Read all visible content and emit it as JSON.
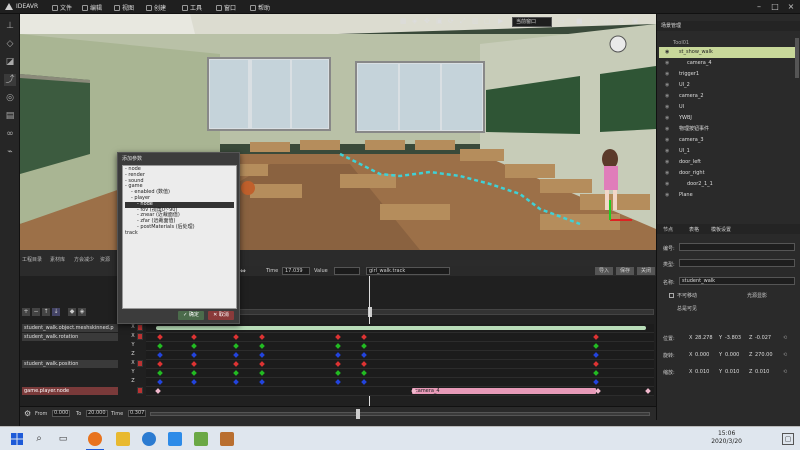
{
  "app": {
    "title": "IDEAVR"
  },
  "menu": [
    "文件",
    "编辑",
    "视图",
    "创建",
    "工具",
    "窗口",
    "帮助"
  ],
  "viewport": {
    "play_mode": "当前窗口"
  },
  "panel_tabs": [
    "工程目录",
    "素材库",
    "方会减少",
    "资源"
  ],
  "dialog": {
    "title": "添加参数",
    "tree": [
      {
        "text": "- node",
        "indent": 0
      },
      {
        "text": "- render",
        "indent": 0
      },
      {
        "text": "- sound",
        "indent": 0
      },
      {
        "text": "- game",
        "indent": 0
      },
      {
        "text": "- enabled (数值)",
        "indent": 1
      },
      {
        "text": "- player",
        "indent": 1
      },
      {
        "text": "- node",
        "indent": 2
      },
      {
        "text": "- fov (视角0~90)",
        "indent": 2
      },
      {
        "text": "- znear (近裁面值)",
        "indent": 2
      },
      {
        "text": "- zfar (远裁面值)",
        "indent": 2
      },
      {
        "text": "- postMaterials (后处理)",
        "indent": 2
      },
      {
        "text": "track",
        "indent": 0
      }
    ],
    "selected_index": 6,
    "ok": "确定",
    "cancel": "取消"
  },
  "track_header": {
    "time_label": "Time",
    "time_value": "17.039",
    "value_label": "Value",
    "track_name": "girl_walk.track",
    "btn_import": "导入",
    "btn_save": "保存",
    "btn_close": "关闭"
  },
  "tracks": [
    {
      "label": "student_walk.object.meshskinned.p",
      "axes": []
    },
    {
      "label": "student_walk.rotation",
      "axes": [
        "X",
        "Y",
        "Z"
      ]
    },
    {
      "label": "student_walk.position",
      "axes": [
        "X",
        "Y",
        "Z"
      ]
    },
    {
      "label": "game.player.node",
      "axes": []
    }
  ],
  "clip_label": "camera_4",
  "timeline": {
    "from_label": "From",
    "from_value": "0.000",
    "to_label": "To",
    "to_value": "20.000",
    "time_label": "Time",
    "time_value": "0.307"
  },
  "scene": {
    "header": "场景管理",
    "root": "Tool01",
    "items": [
      {
        "name": "st_show_walk",
        "indent": 1,
        "selected": true
      },
      {
        "name": "camera_4",
        "indent": 2,
        "selected": false
      },
      {
        "name": "trigger1",
        "indent": 1,
        "selected": false
      },
      {
        "name": "UI_2",
        "indent": 1,
        "selected": false
      },
      {
        "name": "camera_2",
        "indent": 1,
        "selected": false
      },
      {
        "name": "UI",
        "indent": 1,
        "selected": false
      },
      {
        "name": "YWBJ",
        "indent": 1,
        "selected": false
      },
      {
        "name": "物理按钮事件",
        "indent": 1,
        "selected": false
      },
      {
        "name": "camera_3",
        "indent": 1,
        "selected": false
      },
      {
        "name": "UI_1",
        "indent": 1,
        "selected": false
      },
      {
        "name": "door_left",
        "indent": 1,
        "selected": false
      },
      {
        "name": "door_right",
        "indent": 1,
        "selected": false
      },
      {
        "name": "door2_1_1",
        "indent": 2,
        "selected": false
      },
      {
        "name": "Plane",
        "indent": 1,
        "selected": false
      }
    ]
  },
  "properties": {
    "tabs": [
      "节点",
      "表格",
      "模板设置"
    ],
    "id_label": "编号:",
    "type_label": "类型:",
    "name_label": "名称:",
    "name_value": "student_walk",
    "cb_unmovable": "不可移动",
    "cb_shadow": "光源显影",
    "cb_visible": "总是可见",
    "pos_label": "位置:",
    "rot_label": "旋转:",
    "scale_label": "缩放:",
    "pos": [
      "28.278",
      "-3.803",
      "-0.027"
    ],
    "rot": [
      "0.000",
      "0.000",
      "270.00"
    ],
    "scale": [
      "0.010",
      "0.010",
      "0.010"
    ]
  },
  "taskbar": {
    "time": "15:06",
    "date": "2020/3/20"
  },
  "colors": {
    "accent_red": "#b33a3a",
    "clip_pink": "#e79ab8",
    "selection_green": "#c8d89a"
  }
}
